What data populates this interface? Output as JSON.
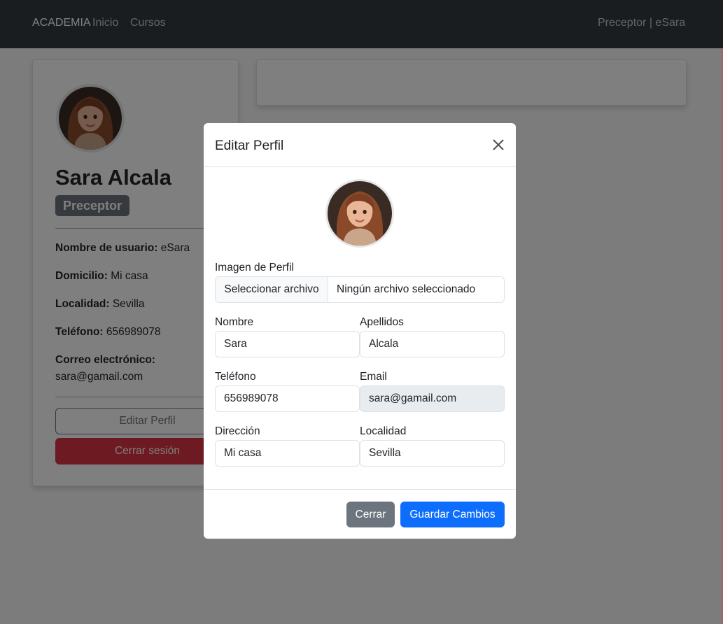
{
  "navbar": {
    "brand": "ACADEMIA",
    "links": [
      "Inicio",
      "Cursos"
    ],
    "user_label": "Preceptor | eSara"
  },
  "profile": {
    "name": "Sara Alcala",
    "role_badge": "Preceptor",
    "fields": [
      {
        "label": "Nombre de usuario:",
        "value": "eSara"
      },
      {
        "label": "Domicilio:",
        "value": "Mi casa"
      },
      {
        "label": "Localidad:",
        "value": "Sevilla"
      },
      {
        "label": "Teléfono:",
        "value": "656989078"
      },
      {
        "label": "Correo electrónico:",
        "value": "sara@gamail.com"
      }
    ],
    "edit_button": "Editar Perfil",
    "logout_button": "Cerrar sesión"
  },
  "modal": {
    "title": "Editar Perfil",
    "image_label": "Imagen de Perfil",
    "file_button": "Seleccionar archivo",
    "file_status": "Ningún archivo seleccionado",
    "nombre_label": "Nombre",
    "nombre_value": "Sara",
    "apellidos_label": "Apellidos",
    "apellidos_value": "Alcala",
    "telefono_label": "Teléfono",
    "telefono_value": "656989078",
    "email_label": "Email",
    "email_value": "sara@gamail.com",
    "direccion_label": "Dirección",
    "direccion_value": "Mi casa",
    "localidad_label": "Localidad",
    "localidad_value": "Sevilla",
    "close_button": "Cerrar",
    "save_button": "Guardar Cambios"
  },
  "colors": {
    "navbar": "#343a40",
    "primary": "#0d6efd",
    "danger": "#dc3545",
    "secondary": "#6c757d"
  },
  "icons": [
    "avatar-image",
    "close-icon"
  ]
}
